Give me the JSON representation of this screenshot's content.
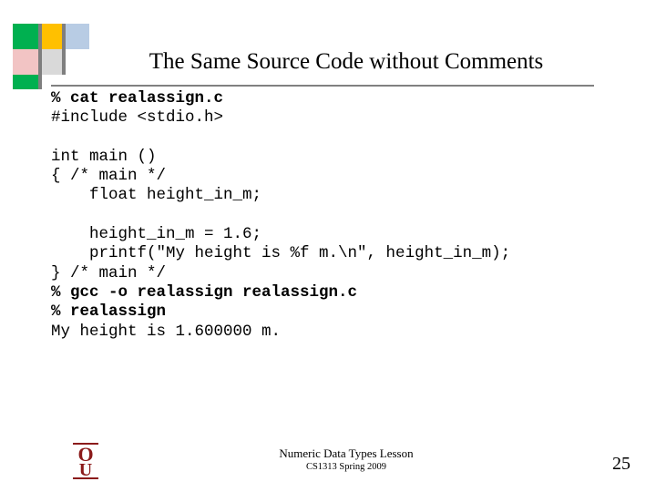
{
  "slide": {
    "title": "The Same Source Code without Comments",
    "page_number": "25"
  },
  "code_lines": [
    {
      "text": "% cat realassign.c",
      "bold": true
    },
    {
      "text": "#include <stdio.h>",
      "bold": false
    },
    {
      "text": "",
      "bold": false
    },
    {
      "text": "int main ()",
      "bold": false
    },
    {
      "text": "{ /* main */",
      "bold": false
    },
    {
      "text": "    float height_in_m;",
      "bold": false
    },
    {
      "text": "",
      "bold": false
    },
    {
      "text": "    height_in_m = 1.6;",
      "bold": false
    },
    {
      "text": "    printf(\"My height is %f m.\\n\", height_in_m);",
      "bold": false
    },
    {
      "text": "} /* main */",
      "bold": false
    },
    {
      "text": "% gcc -o realassign realassign.c",
      "bold": true
    },
    {
      "text": "% realassign",
      "bold": true
    },
    {
      "text": "My height is 1.600000 m.",
      "bold": false
    }
  ],
  "footer": {
    "lesson": "Numeric Data Types Lesson",
    "course": "CS1313 Spring 2009"
  },
  "logo": {
    "label": "OU",
    "color": "#8b1a1a"
  },
  "colors": {
    "green": "#00b050",
    "yellow": "#ffc000",
    "blue": "#b8cce4",
    "pink": "#f2c4c4",
    "gray": "#d9d9d9",
    "rule": "#808080"
  }
}
